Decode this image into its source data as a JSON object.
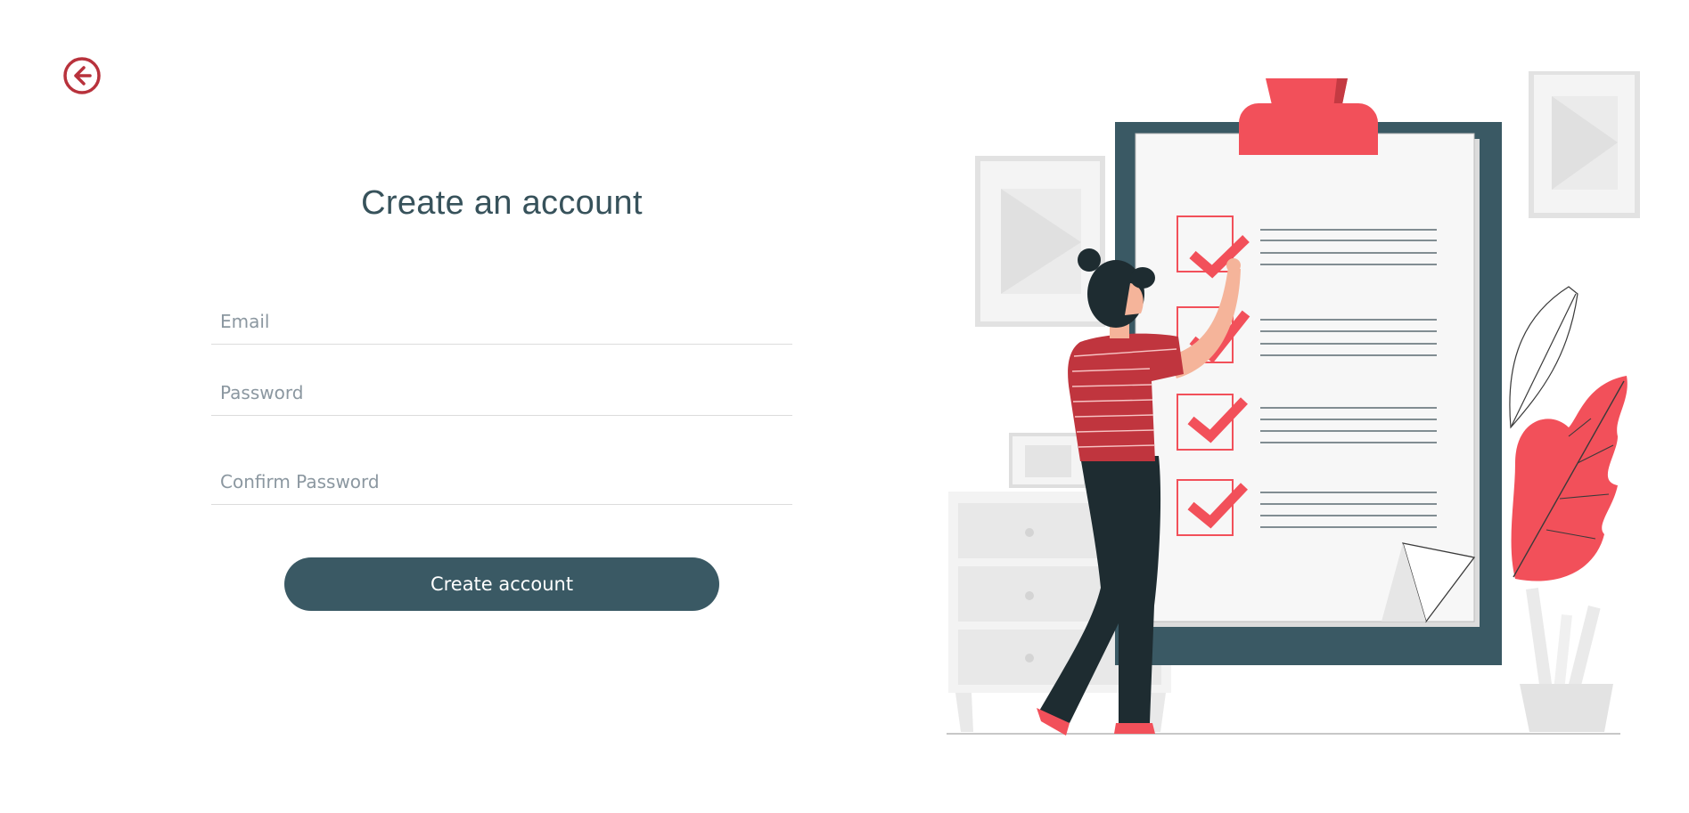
{
  "title": "Create an account",
  "form": {
    "email_placeholder": "Email",
    "password_placeholder": "Password",
    "confirm_password_placeholder": "Confirm Password",
    "submit_label": "Create account"
  },
  "icons": {
    "back": "arrow-left-circle-icon"
  },
  "colors": {
    "accent": "#b8323c",
    "primary": "#3a5964",
    "title_text": "#37525b",
    "placeholder": "#8b97a0",
    "illustration_red": "#f2505a"
  }
}
